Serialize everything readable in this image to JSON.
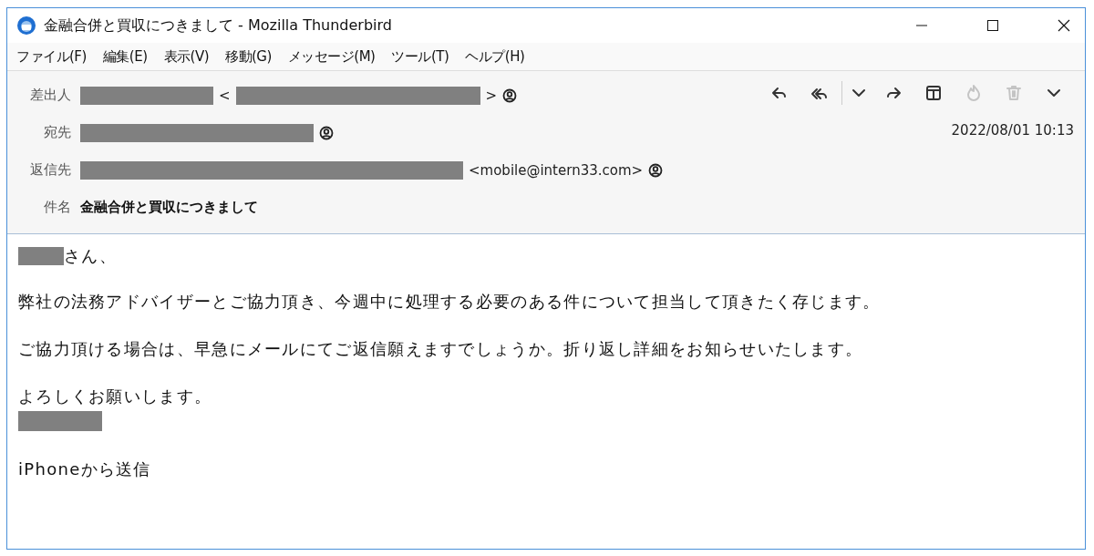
{
  "window": {
    "title": "金融合併と買収につきまして - Mozilla Thunderbird"
  },
  "menu": [
    "ファイル(F)",
    "編集(E)",
    "表示(V)",
    "移動(G)",
    "メッセージ(M)",
    "ツール(T)",
    "ヘルプ(H)"
  ],
  "toolbar": [
    {
      "kind": "reply",
      "disabled": false
    },
    {
      "kind": "reply-all",
      "disabled": false
    },
    {
      "kind": "dropdown",
      "disabled": false
    },
    {
      "kind": "forward",
      "disabled": false
    },
    {
      "kind": "archive",
      "disabled": false
    },
    {
      "kind": "junk",
      "disabled": true
    },
    {
      "kind": "delete",
      "disabled": true
    },
    {
      "kind": "more",
      "disabled": false
    }
  ],
  "date": "2022/08/01 10:13",
  "header_fields": [
    {
      "label": "差出人",
      "parts": [
        {
          "kind": "redacted"
        },
        {
          "kind": "text",
          "text": "<"
        },
        {
          "kind": "redacted"
        },
        {
          "kind": "text",
          "text": ">"
        },
        {
          "kind": "contact"
        }
      ]
    },
    {
      "label": "宛先",
      "parts": [
        {
          "kind": "redacted"
        },
        {
          "kind": "contact"
        }
      ]
    },
    {
      "label": "返信先",
      "parts": [
        {
          "kind": "redacted"
        },
        {
          "kind": "text",
          "text": "<mobile@intern33.com>"
        },
        {
          "kind": "contact"
        }
      ]
    },
    {
      "label": "件名",
      "parts": [
        {
          "kind": "subject",
          "text": "金融合併と買収につきまして"
        }
      ]
    }
  ],
  "body": [
    {
      "kind": "greeting",
      "text": "さん、"
    },
    {
      "kind": "paragraph",
      "text": "弊社の法務アドバイザーとご協力頂き、今週中に処理する必要のある件について担当して頂きたく存じます。"
    },
    {
      "kind": "paragraph",
      "text": "ご協力頂ける場合は、早急にメールにてご返信願えますでしょうか。折り返し詳細をお知らせいたします。"
    },
    {
      "kind": "closing",
      "text": "よろしくお願いします。"
    },
    {
      "kind": "signature"
    },
    {
      "kind": "paragraph",
      "text": "iPhoneから送信"
    }
  ]
}
